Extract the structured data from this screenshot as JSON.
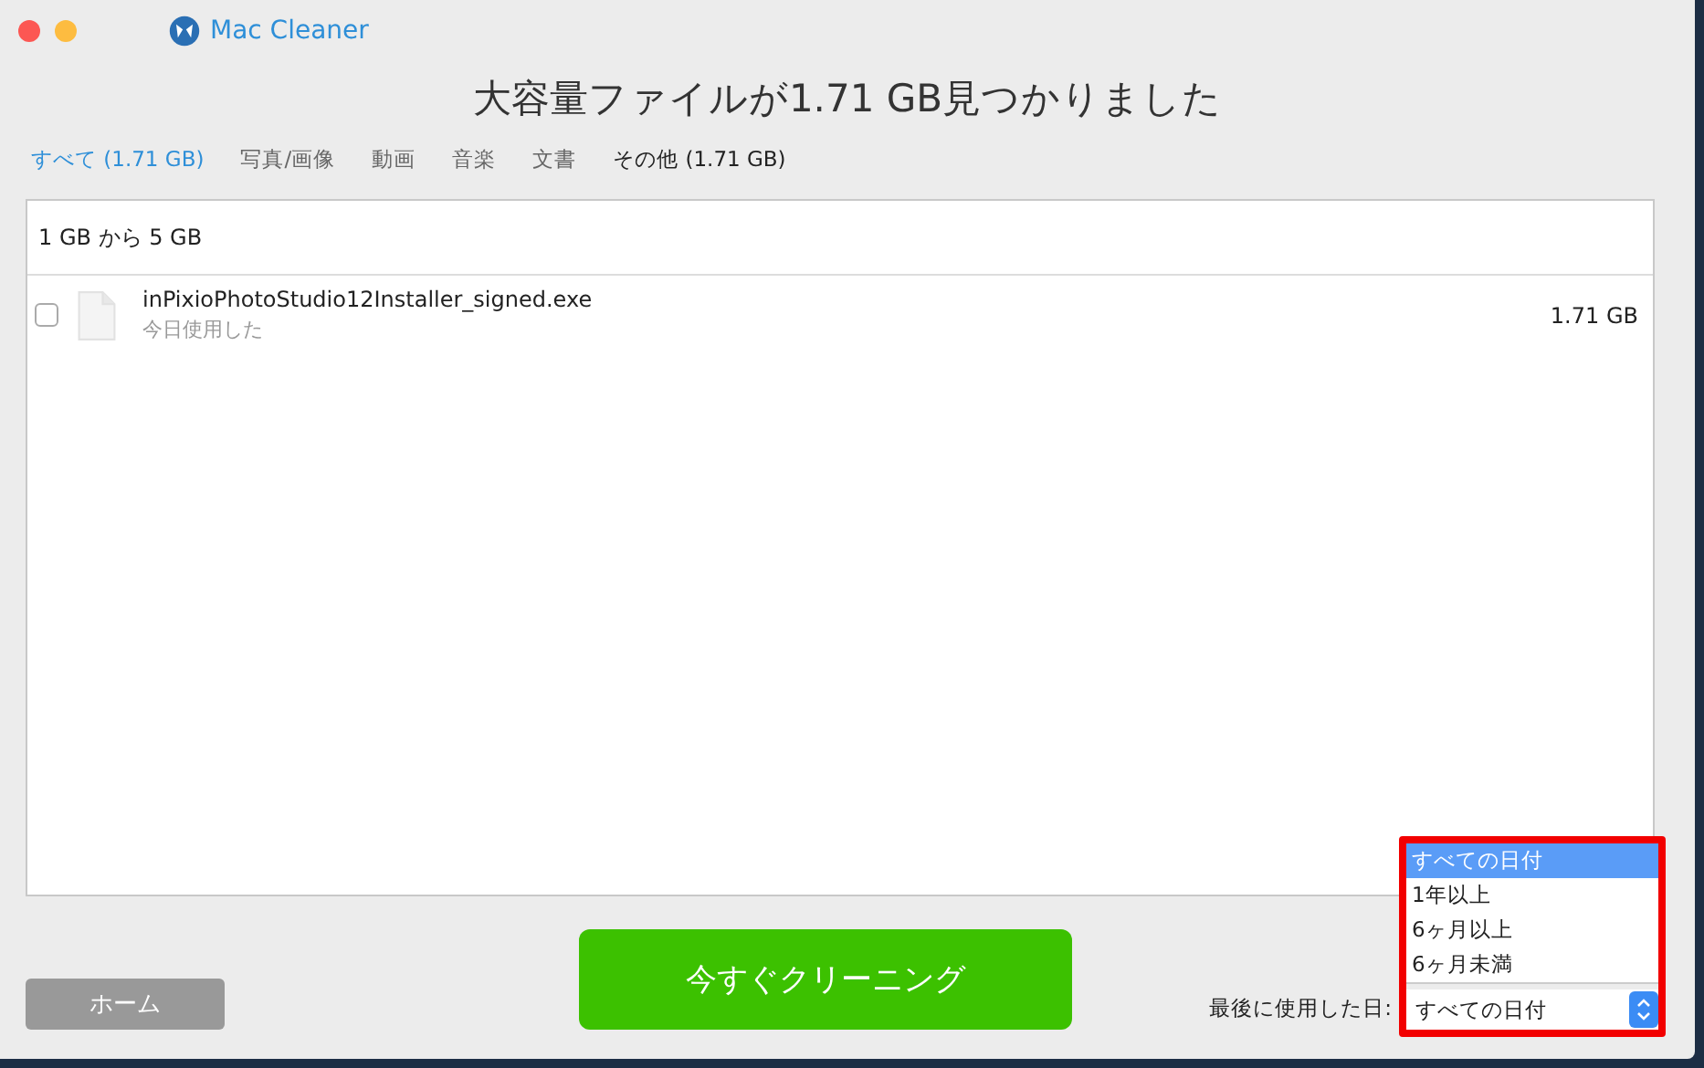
{
  "window": {
    "app_name": "Mac Cleaner"
  },
  "heading": "大容量ファイルが1.71 GB見つかりました",
  "tabs": [
    {
      "label": "すべて (1.71 GB)",
      "selected": true,
      "has_files": true
    },
    {
      "label": "写真/画像",
      "selected": false,
      "has_files": false
    },
    {
      "label": "動画",
      "selected": false,
      "has_files": false
    },
    {
      "label": "音楽",
      "selected": false,
      "has_files": false
    },
    {
      "label": "文書",
      "selected": false,
      "has_files": false
    },
    {
      "label": "その他 (1.71 GB)",
      "selected": false,
      "has_files": true
    }
  ],
  "file_list": {
    "group_header": "1 GB から 5 GB",
    "rows": [
      {
        "checked": false,
        "name": "inPixioPhotoStudio12Installer_signed.exe",
        "last_used": "今日使用した",
        "size": "1.71 GB"
      }
    ]
  },
  "home_button": "ホーム",
  "clean_button": "今すぐクリーニング",
  "date_filter": {
    "label": "最後に使用した日:",
    "value": "すべての日付",
    "expanded": true,
    "highlighted": true,
    "options": [
      {
        "label": "すべての日付",
        "selected": true
      },
      {
        "label": "1年以上",
        "selected": false
      },
      {
        "label": "6ヶ月以上",
        "selected": false
      },
      {
        "label": "6ヶ月未満",
        "selected": false
      }
    ]
  }
}
